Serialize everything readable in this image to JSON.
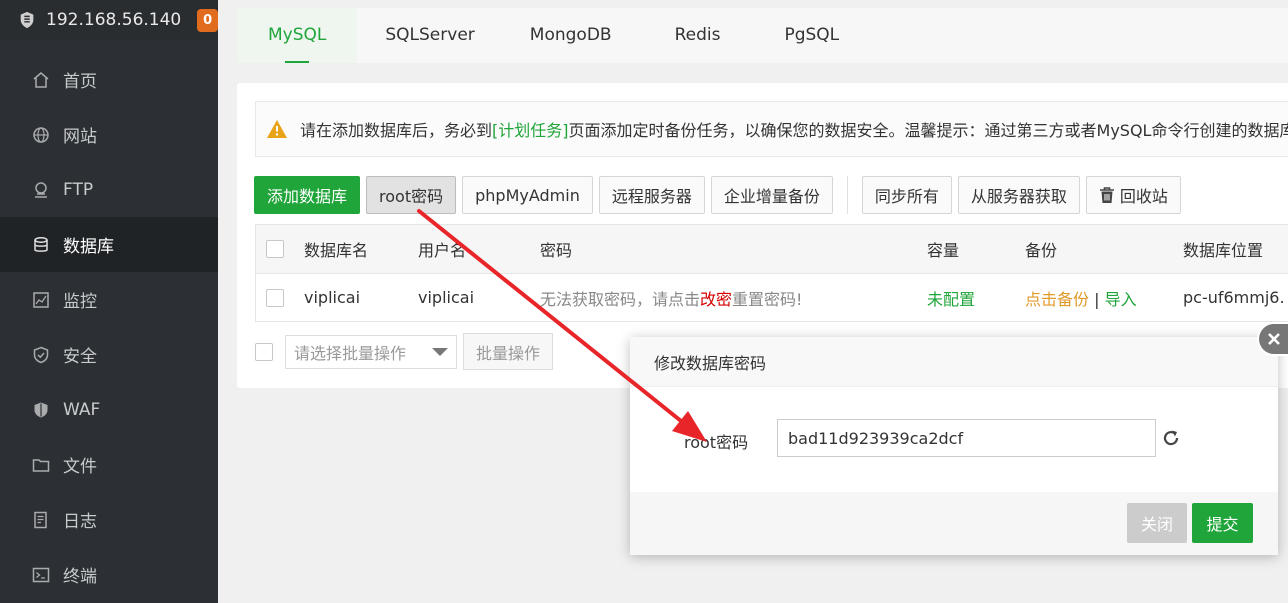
{
  "sidebar": {
    "server_ip": "192.168.56.140",
    "badge_count": "0",
    "items": [
      {
        "label": "首页",
        "icon": "home-icon"
      },
      {
        "label": "网站",
        "icon": "globe-icon"
      },
      {
        "label": "FTP",
        "icon": "ftp-icon"
      },
      {
        "label": "数据库",
        "icon": "database-icon",
        "active": true
      },
      {
        "label": "监控",
        "icon": "monitor-icon"
      },
      {
        "label": "安全",
        "icon": "shield-icon"
      },
      {
        "label": "WAF",
        "icon": "waf-icon"
      },
      {
        "label": "文件",
        "icon": "folder-icon"
      },
      {
        "label": "日志",
        "icon": "log-icon"
      },
      {
        "label": "终端",
        "icon": "terminal-icon"
      }
    ]
  },
  "tabs": [
    "MySQL",
    "SQLServer",
    "MongoDB",
    "Redis",
    "PgSQL"
  ],
  "notice": {
    "prefix": "请在添加数据库后，务必到",
    "link": "[计划任务]",
    "suffix": "页面添加定时备份任务，以确保您的数据安全。温馨提示：通过第三方或者MySQL命令行创建的数据库"
  },
  "toolbar": {
    "add_db": "添加数据库",
    "root_pwd": "root密码",
    "phpmyadmin": "phpMyAdmin",
    "remote_server": "远程服务器",
    "enterprise_backup": "企业增量备份",
    "sync_all": "同步所有",
    "fetch_from_server": "从服务器获取",
    "recycle_bin": "回收站"
  },
  "table": {
    "headers": {
      "db_name": "数据库名",
      "user_name": "用户名",
      "password": "密码",
      "capacity": "容量",
      "backup": "备份",
      "location": "数据库位置"
    },
    "rows": [
      {
        "db_name": "viplicai",
        "user_name": "viplicai",
        "pwd_prefix": "无法获取密码，请点击",
        "pwd_link": "改密",
        "pwd_suffix": "重置密码!",
        "capacity": "未配置",
        "backup_link": "点击备份",
        "backup_sep": " | ",
        "import_link": "导入",
        "location": "pc-uf6mmj6."
      }
    ]
  },
  "batch": {
    "select_placeholder": "请选择批量操作",
    "button": "批量操作"
  },
  "modal": {
    "title": "修改数据库密码",
    "field_label": "root密码",
    "field_value": "bad11d923939ca2dcf",
    "close": "关闭",
    "submit": "提交"
  },
  "colors": {
    "accent": "#20a53a",
    "annotation_arrow": "#e8262a"
  }
}
